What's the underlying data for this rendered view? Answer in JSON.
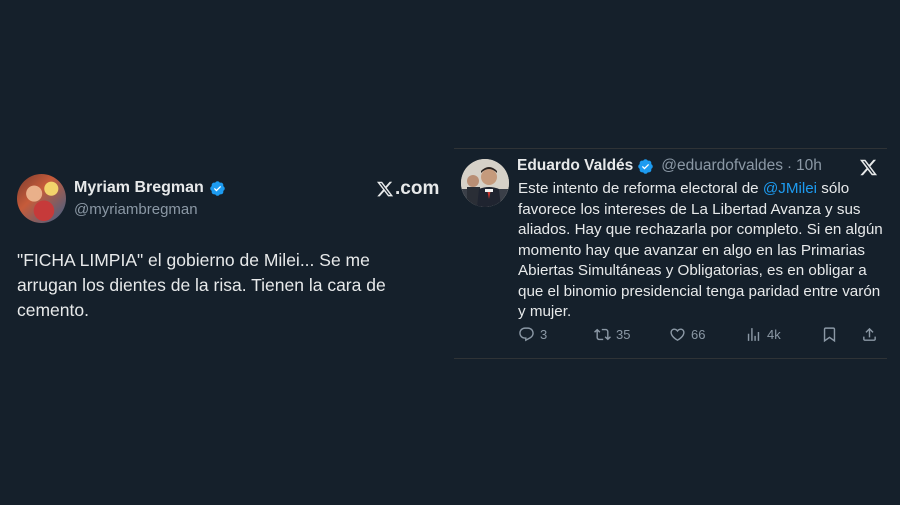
{
  "left_tweet": {
    "name": "Myriam Bregman",
    "handle": "@myriambregman",
    "brand": ".com",
    "text": "\"FICHA LIMPIA\"  el gobierno de Milei... Se me arrugan los dientes de la risa. Tienen la cara de cemento."
  },
  "right_tweet": {
    "name": "Eduardo Valdés",
    "handle": "@eduardofvaldes",
    "separator": "·",
    "time": "10h",
    "text_before": "Este intento de reforma electoral de ",
    "mention": "@JMilei",
    "text_after": " sólo favorece los intereses de La Libertad Avanza y sus aliados. Hay que rechazarla por completo. Si en algún momento hay que avanzar en algo en las Primarias Abiertas Simultáneas y Obligatorias, es en obligar a que el binomio presidencial tenga paridad entre varón y mujer.",
    "stats": {
      "replies": "3",
      "reposts": "35",
      "likes": "66",
      "views": "4k"
    }
  },
  "colors": {
    "background": "#15202b",
    "text": "#e7e9ea",
    "muted": "#8b98a5",
    "accent": "#1d9bf0"
  },
  "icons": [
    "verified-badge-icon",
    "x-logo-icon",
    "reply-icon",
    "repost-icon",
    "like-icon",
    "views-icon",
    "bookmark-icon",
    "share-icon"
  ]
}
